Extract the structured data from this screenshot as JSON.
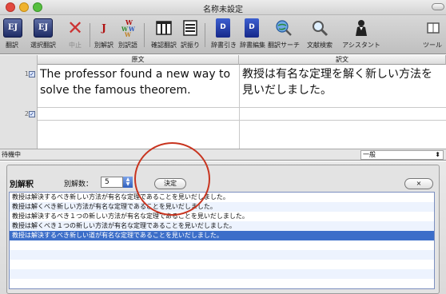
{
  "window": {
    "title": "名称未設定"
  },
  "toolbar": {
    "items": [
      {
        "name": "translate",
        "label": "翻訳",
        "icon": "ej-icon",
        "glyph": "EJ",
        "enabled": true
      },
      {
        "name": "selection-translate",
        "label": "選択翻訳",
        "icon": "ej-selection-icon",
        "glyph": "EJ",
        "enabled": true
      },
      {
        "name": "stop",
        "label": "中止",
        "icon": "stop-x-icon",
        "glyph": "✕",
        "enabled": false
      },
      {
        "name": "alt-translation",
        "label": "別解訳",
        "icon": "alt-translation-icon",
        "glyph": "J",
        "enabled": true
      },
      {
        "name": "alt-words",
        "label": "別訳語",
        "icon": "alt-words-icon",
        "glyph": "W",
        "enabled": true
      },
      {
        "name": "confirm-translate",
        "label": "確認翻訳",
        "icon": "columns-icon",
        "glyph": "▥",
        "enabled": true
      },
      {
        "name": "wrap",
        "label": "訳振り",
        "icon": "lines-icon",
        "glyph": "☰",
        "enabled": true
      },
      {
        "name": "dictionary-lookup",
        "label": "辞書引き",
        "icon": "dictionary-icon",
        "glyph": "D",
        "enabled": true
      },
      {
        "name": "dictionary-edit",
        "label": "辞書編集",
        "icon": "dictionary-edit-icon",
        "glyph": "D",
        "enabled": true
      },
      {
        "name": "translation-search",
        "label": "翻訳サーチ",
        "icon": "globe-search-icon",
        "glyph": "🌐",
        "enabled": true
      },
      {
        "name": "text-search",
        "label": "文献検索",
        "icon": "magnifier-icon",
        "glyph": "🔍",
        "enabled": true
      },
      {
        "name": "assistant",
        "label": "アシスタント",
        "icon": "assistant-icon",
        "glyph": "♛",
        "enabled": true
      },
      {
        "name": "tools",
        "label": "ツール",
        "icon": "tools-icon",
        "glyph": "▤",
        "enabled": true
      }
    ]
  },
  "table": {
    "headers": {
      "source": "原文",
      "translation": "訳文"
    },
    "rows": [
      {
        "number": "1",
        "checked": true,
        "source_line1": "The professor found a new way to",
        "source_line2": "solve the famous theorem.",
        "translation_line1": "教授は有名な定理を解く新しい方法を",
        "translation_line2": "見いだしました。"
      },
      {
        "number": "2",
        "checked": true,
        "source_line1": "",
        "source_line2": "",
        "translation_line1": "",
        "translation_line2": ""
      }
    ]
  },
  "status": {
    "text": "待機中",
    "mode": "一般",
    "mode_arrow": "⬍"
  },
  "alt_panel": {
    "title": "別解釈",
    "count_label": "別解数：",
    "count_value": "5",
    "decide_label": "決定",
    "close_label": "×",
    "items": [
      "教授は解決するべき新しい方法が有名な定理であることを見いだしました。",
      "教授は解くべき新しい方法が有名な定理であることを見いだしました。",
      "教授は解決するべき１つの新しい方法が有名な定理であることを見いだしました。",
      "教授は解くべき１つの新しい方法が有名な定理であることを見いだしました。",
      "教授は解決するべき新しい道が有名な定理であることを見いだしました。"
    ],
    "selected_index": 4
  },
  "colors": {
    "selection": "#3c6ec9",
    "annotation": "#c8341f",
    "ej_icon": "#1f2c66",
    "stop_icon": "#cc3333"
  }
}
